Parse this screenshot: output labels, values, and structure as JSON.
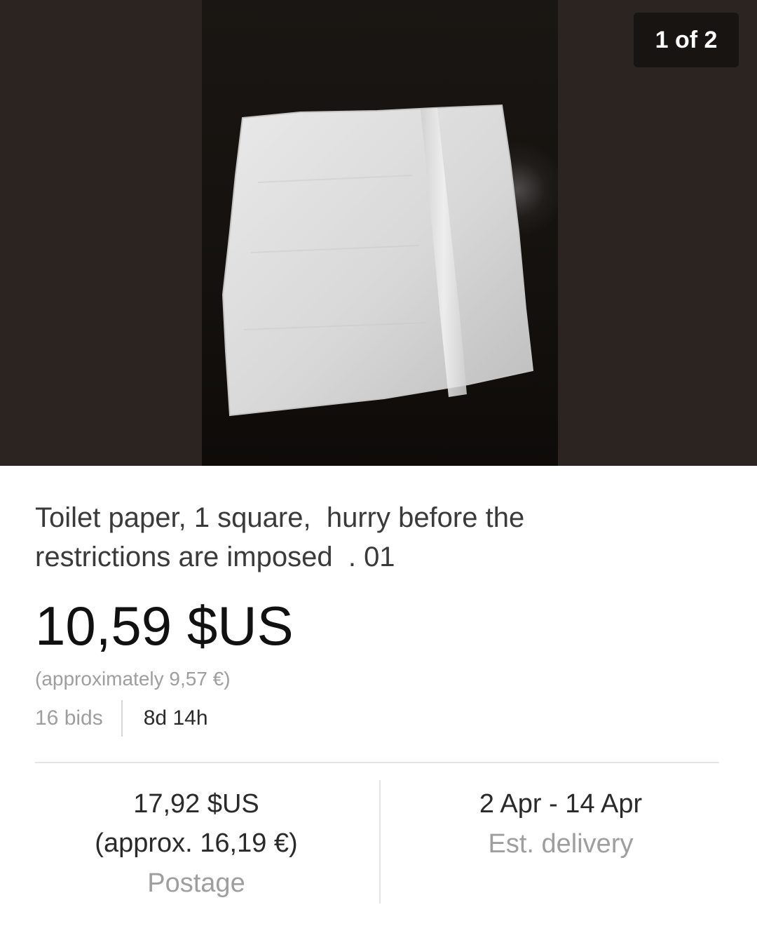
{
  "gallery": {
    "counter": "1 of 2"
  },
  "listing": {
    "title": "Toilet paper, 1 square,  hurry before the\nrestrictions are imposed  . 01",
    "price": "10,59 $US",
    "approx_price": "(approximately 9,57 €)",
    "bids": "16 bids",
    "time_left": "8d 14h"
  },
  "postage": {
    "amount": "17,92 $US",
    "approx": "(approx. 16,19 €)",
    "label": "Postage"
  },
  "delivery": {
    "dates": "2 Apr - 14 Apr",
    "label": "Est. delivery"
  },
  "colors": {
    "gallery_background": "#2b2420",
    "text_primary": "#111111",
    "text_muted": "#9e9e9e"
  },
  "icons": {
    "product_image": "toilet-paper-square-photo"
  }
}
